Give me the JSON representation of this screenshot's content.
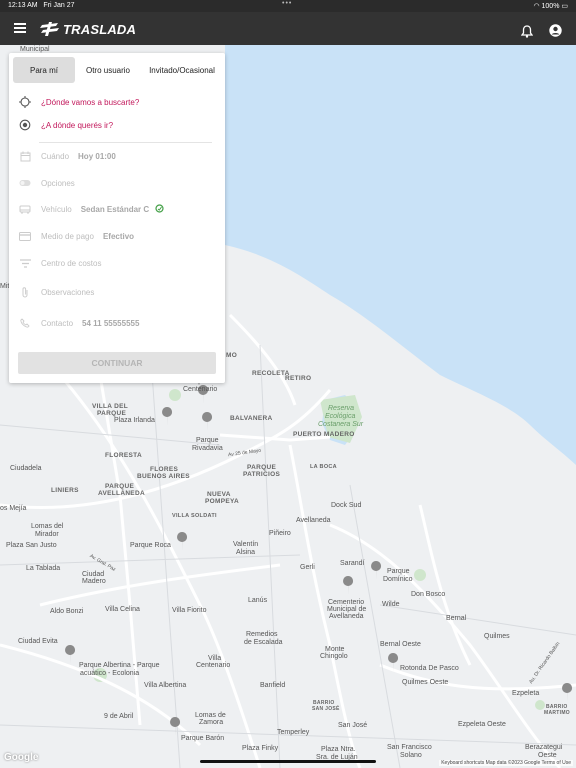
{
  "status_bar": {
    "time": "12:13 AM",
    "date": "Fri Jan 27",
    "dots": "•••",
    "battery": "100%"
  },
  "app": {
    "brand": "TRASLADA"
  },
  "panel": {
    "tabs": [
      {
        "label": "Para mí",
        "active": true
      },
      {
        "label": "Otro usuario",
        "active": false
      },
      {
        "label": "Invitado/Ocasional",
        "active": false
      }
    ],
    "pickup_placeholder": "¿Dónde vamos a buscarte?",
    "dropoff_placeholder": "¿A dónde querés ir?",
    "when": {
      "label": "Cuándo",
      "value": "Hoy 01:00"
    },
    "options": {
      "label": "Opciones"
    },
    "vehicle": {
      "label": "Vehículo",
      "value": "Sedan Estándar C"
    },
    "payment": {
      "label": "Medio de pago",
      "value": "Efectivo"
    },
    "cost_center": {
      "label": "Centro de costos"
    },
    "notes": {
      "label": "Observaciones"
    },
    "contact": {
      "label": "Contacto",
      "value": "54 11 55555555"
    },
    "continue_label": "CONTINUAR"
  },
  "map": {
    "labels": [
      {
        "t": "Municipal",
        "k": "n"
      },
      {
        "t": "Mit",
        "k": "n"
      },
      {
        "t": "MO",
        "k": "b"
      },
      {
        "t": "RECOLETA",
        "k": "b"
      },
      {
        "t": "RETIRO",
        "k": "b"
      },
      {
        "t": "Parque",
        "k": "n"
      },
      {
        "t": "Centenario",
        "k": "n"
      },
      {
        "t": "VILLA DEL",
        "k": "b"
      },
      {
        "t": "PARQUE",
        "k": "b"
      },
      {
        "t": "Plaza Irlanda",
        "k": "n"
      },
      {
        "t": "BALVANERA",
        "k": "b"
      },
      {
        "t": "Reserva",
        "k": "g"
      },
      {
        "t": "Ecológica",
        "k": "g"
      },
      {
        "t": "Costanera Sur",
        "k": "g"
      },
      {
        "t": "PUERTO MADERO",
        "k": "b"
      },
      {
        "t": "Parque",
        "k": "n"
      },
      {
        "t": "Rivadavia",
        "k": "n"
      },
      {
        "t": "FLORESTA",
        "k": "b"
      },
      {
        "t": "Av 25 de Mayo",
        "k": "n"
      },
      {
        "t": "Ciudadela",
        "k": "n"
      },
      {
        "t": "FLORES",
        "k": "b"
      },
      {
        "t": "BUENOS AIRES",
        "k": "b"
      },
      {
        "t": "PARQUE",
        "k": "b"
      },
      {
        "t": "PATRICIOS",
        "k": "b"
      },
      {
        "t": "LA BOCA",
        "k": "b"
      },
      {
        "t": "LINIERS",
        "k": "b"
      },
      {
        "t": "PARQUE",
        "k": "b"
      },
      {
        "t": "AVELLANEDA",
        "k": "b"
      },
      {
        "t": "NUEVA",
        "k": "b"
      },
      {
        "t": "POMPEYA",
        "k": "b"
      },
      {
        "t": "Dock Sud",
        "k": "n"
      },
      {
        "t": "os Mejía",
        "k": "n"
      },
      {
        "t": "VILLA SOLDATI",
        "k": "b"
      },
      {
        "t": "Avellaneda",
        "k": "n"
      },
      {
        "t": "Lomas del",
        "k": "n"
      },
      {
        "t": "Mirador",
        "k": "n"
      },
      {
        "t": "Plaza San Justo",
        "k": "n"
      },
      {
        "t": "Parque Roca",
        "k": "n"
      },
      {
        "t": "Valentín",
        "k": "n"
      },
      {
        "t": "Alsina",
        "k": "n"
      },
      {
        "t": "Piñeiro",
        "k": "n"
      },
      {
        "t": "Sarandí",
        "k": "n"
      },
      {
        "t": "La Tablada",
        "k": "n"
      },
      {
        "t": "Ciudad",
        "k": "n"
      },
      {
        "t": "Madero",
        "k": "n"
      },
      {
        "t": "Gerli",
        "k": "n"
      },
      {
        "t": "Parque",
        "k": "n"
      },
      {
        "t": "Domínico",
        "k": "n"
      },
      {
        "t": "Aldo Bonzi",
        "k": "n"
      },
      {
        "t": "Villa Celina",
        "k": "n"
      },
      {
        "t": "Villa Fiorito",
        "k": "n"
      },
      {
        "t": "Lanús",
        "k": "n"
      },
      {
        "t": "Cementerio",
        "k": "n"
      },
      {
        "t": "Municipal de",
        "k": "n"
      },
      {
        "t": "Avellaneda",
        "k": "n"
      },
      {
        "t": "Wilde",
        "k": "n"
      },
      {
        "t": "Don Bosco",
        "k": "n"
      },
      {
        "t": "Bernal",
        "k": "n"
      },
      {
        "t": "Ciudad Evita",
        "k": "n"
      },
      {
        "t": "Remedios",
        "k": "n"
      },
      {
        "t": "de Escalada",
        "k": "n"
      },
      {
        "t": "Monte",
        "k": "n"
      },
      {
        "t": "Chingolo",
        "k": "n"
      },
      {
        "t": "Bernal Oeste",
        "k": "n"
      },
      {
        "t": "Quilmes",
        "k": "n"
      },
      {
        "t": "Parque Albertina - Parque",
        "k": "n"
      },
      {
        "t": "acuático - Ecolonia",
        "k": "n"
      },
      {
        "t": "Villa",
        "k": "n"
      },
      {
        "t": "Centenario",
        "k": "n"
      },
      {
        "t": "Rotonda De Pasco",
        "k": "n"
      },
      {
        "t": "Villa Albertina",
        "k": "n"
      },
      {
        "t": "Banfield",
        "k": "n"
      },
      {
        "t": "Quilmes Oeste",
        "k": "n"
      },
      {
        "t": "Ezpeleta",
        "k": "n"
      },
      {
        "t": "BARRIO",
        "k": "b"
      },
      {
        "t": "SAN JOSÉ",
        "k": "b"
      },
      {
        "t": "9 de Abril",
        "k": "n"
      },
      {
        "t": "Lomas de",
        "k": "n"
      },
      {
        "t": "Zamora",
        "k": "n"
      },
      {
        "t": "Temperley",
        "k": "n"
      },
      {
        "t": "San José",
        "k": "n"
      },
      {
        "t": "Ezpeleta Oeste",
        "k": "n"
      },
      {
        "t": "Parque Barón",
        "k": "n"
      },
      {
        "t": "Plaza Finky",
        "k": "n"
      },
      {
        "t": "Plaza Ntra.",
        "k": "n"
      },
      {
        "t": "Sra. de Luján",
        "k": "n"
      },
      {
        "t": "San Francisco",
        "k": "n"
      },
      {
        "t": "Solano",
        "k": "n"
      },
      {
        "t": "Berazategui",
        "k": "n"
      },
      {
        "t": "Oeste",
        "k": "n"
      },
      {
        "t": "BARRIO",
        "k": "b"
      },
      {
        "t": "MARTIMO",
        "k": "b"
      },
      {
        "t": "Au. Dr. Ricardo Balbín",
        "k": "n"
      },
      {
        "t": "Av. Gral. Paz",
        "k": "n"
      }
    ],
    "google": "Google",
    "attribution": "Keyboard shortcuts   Map data ©2023 Google   Terms of Use",
    "colors": {
      "water": "#c9e2f7",
      "land": "#eef0f2",
      "road": "#ffffff",
      "park": "#cfe6cc"
    }
  }
}
